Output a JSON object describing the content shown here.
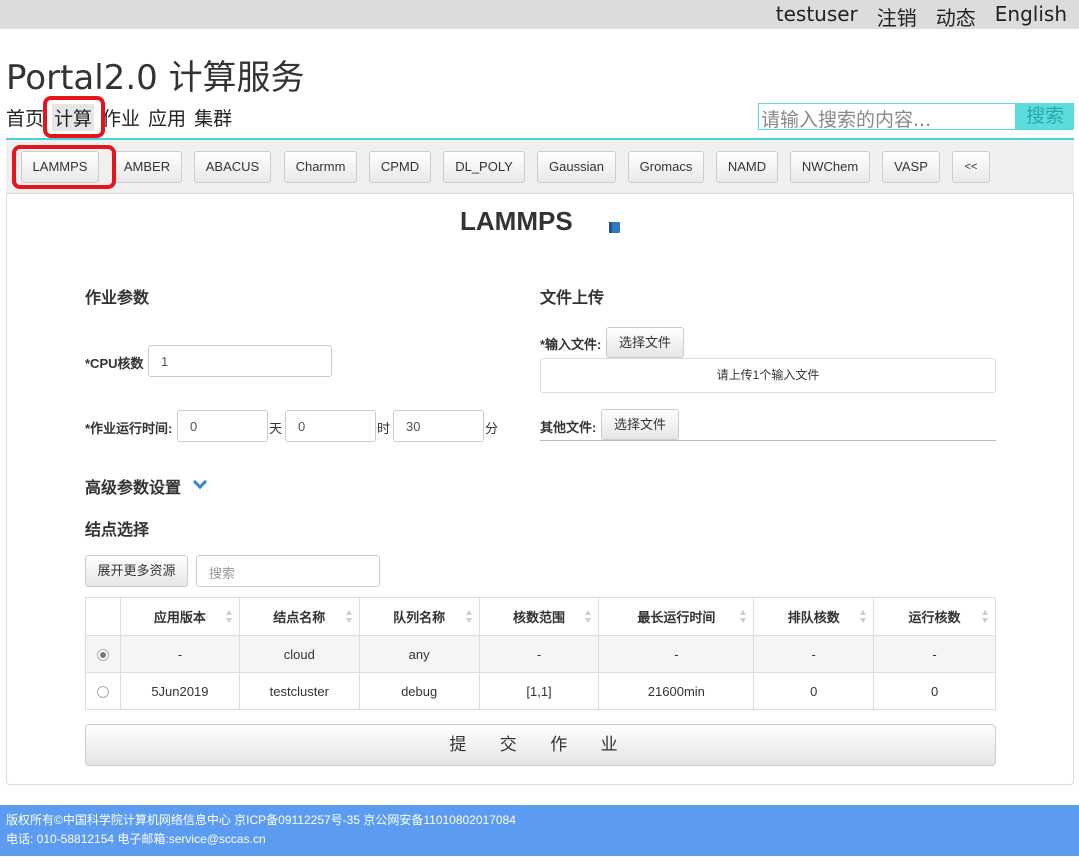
{
  "topbar": {
    "user": "testuser",
    "logout": "注销",
    "news": "动态",
    "language": "English"
  },
  "portal_title": "Portal2.0 计算服务",
  "nav": {
    "home": "首页",
    "compute": "计算",
    "jobs": "作业",
    "apps": "应用",
    "cluster": "集群"
  },
  "search": {
    "placeholder": "请输入搜索的内容...",
    "button": "搜索"
  },
  "app_tabs": [
    "LAMMPS",
    "AMBER",
    "ABACUS",
    "Charmm",
    "CPMD",
    "DL_POLY",
    "Gaussian",
    "Gromacs",
    "NAMD",
    "NWChem",
    "VASP",
    "<<"
  ],
  "app_title": "LAMMPS",
  "job_params": {
    "title": "作业参数",
    "cpu_label": "*CPU核数",
    "cpu_value": "1",
    "runtime_label": "*作业运行时间:",
    "days_value": "0",
    "days_unit": "天",
    "hours_value": "0",
    "hours_unit": "时",
    "minutes_value": "30",
    "minutes_unit": "分"
  },
  "file_upload": {
    "title": "文件上传",
    "input_label": "*输入文件:",
    "input_button": "选择文件",
    "input_hint": "请上传1个输入文件",
    "other_label": "其他文件:",
    "other_button": "选择文件"
  },
  "advanced": {
    "title": "高级参数设置"
  },
  "node_select": {
    "title": "结点选择",
    "expand_button": "展开更多资源",
    "search_placeholder": "搜索",
    "columns": [
      "应用版本",
      "结点名称",
      "队列名称",
      "核数范围",
      "最长运行时间",
      "排队核数",
      "运行核数"
    ],
    "rows": [
      {
        "selected": true,
        "cells": [
          "-",
          "cloud",
          "any",
          "-",
          "-",
          "-",
          "-"
        ]
      },
      {
        "selected": false,
        "cells": [
          "5Jun2019",
          "testcluster",
          "debug",
          "[1,1]",
          "21600min",
          "0",
          "0"
        ]
      }
    ]
  },
  "submit_label": "提 交 作 业",
  "footer": {
    "line1": "版权所有©中国科学院计算机网络信息中心 京ICP备09112257号-35 京公网安备11010802017084",
    "line2": "电话: 010-58812154 电子邮箱:service@sccas.cn"
  },
  "colors": {
    "accent_cyan": "#43d3d5",
    "highlight_red": "#e8131b",
    "footer_blue": "#5b9cf0"
  }
}
